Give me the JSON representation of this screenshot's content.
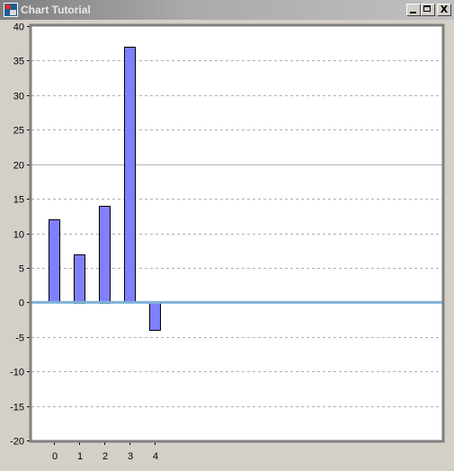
{
  "window": {
    "title": "Chart Tutorial",
    "minimize_label": "_",
    "maximize_label": "□",
    "close_label": "X"
  },
  "chart_data": {
    "type": "bar",
    "categories": [
      "0",
      "1",
      "2",
      "3",
      "4"
    ],
    "values": [
      12,
      7,
      14,
      37,
      -4
    ],
    "ylim": [
      -20,
      40
    ],
    "yticks": [
      -20,
      -15,
      -10,
      -5,
      0,
      5,
      10,
      15,
      20,
      25,
      30,
      35,
      40
    ],
    "title": "",
    "xlabel": "",
    "ylabel": "",
    "grid": true,
    "legend": "none",
    "colors": {
      "bar_fill": "#8080ff",
      "bar_stroke": "#000000",
      "zero_line": "#7fb2d8",
      "grid": "#b0b0b0",
      "plot_background": "#ffffff",
      "axis_frame": "#808080"
    }
  }
}
